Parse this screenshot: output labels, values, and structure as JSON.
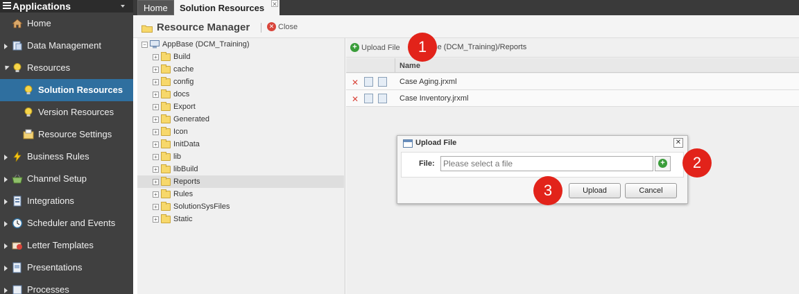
{
  "sidebar": {
    "title": "Applications",
    "items": [
      {
        "label": "Home",
        "icon": "home-icon"
      },
      {
        "label": "Data Management",
        "icon": "data-management-icon"
      },
      {
        "label": "Resources",
        "icon": "lightbulb-icon"
      },
      {
        "label": "Solution Resources",
        "icon": "lightbulb-icon",
        "active": true
      },
      {
        "label": "Version Resources",
        "icon": "lightbulb-icon"
      },
      {
        "label": "Resource Settings",
        "icon": "settings-folder-icon"
      },
      {
        "label": "Business Rules",
        "icon": "lightning-icon"
      },
      {
        "label": "Channel Setup",
        "icon": "basket-icon"
      },
      {
        "label": "Integrations",
        "icon": "integrations-icon"
      },
      {
        "label": "Scheduler and Events",
        "icon": "clock-icon"
      },
      {
        "label": "Letter Templates",
        "icon": "letter-icon"
      },
      {
        "label": "Presentations",
        "icon": "presentation-icon"
      },
      {
        "label": "Processes",
        "icon": "process-icon"
      }
    ]
  },
  "tabs": {
    "home": "Home",
    "active": "Solution Resources"
  },
  "toolbar": {
    "title": "Resource Manager",
    "close_label": "Close"
  },
  "tree": {
    "root": "AppBase (DCM_Training)",
    "nodes": [
      "Build",
      "cache",
      "config",
      "docs",
      "Export",
      "Generated",
      "Icon",
      "InitData",
      "lib",
      "libBuild",
      "Reports",
      "Rules",
      "SolutionSysFiles",
      "Static"
    ],
    "selected": "Reports"
  },
  "content": {
    "upload_label": "Upload File",
    "path": "ase (DCM_Training)/Reports",
    "column_name": "Name",
    "files": [
      "Case Aging.jrxml",
      "Case Inventory.jrxml"
    ]
  },
  "dialog": {
    "title": "Upload File",
    "file_label": "File:",
    "file_placeholder": "Please select a file",
    "upload_button": "Upload",
    "cancel_button": "Cancel",
    "close_glyph": "✕"
  },
  "callouts": [
    "1",
    "2",
    "3"
  ],
  "colors": {
    "sidebar_bg": "#404040",
    "active_nav": "#2f6f9f",
    "callout": "#e2231a"
  }
}
